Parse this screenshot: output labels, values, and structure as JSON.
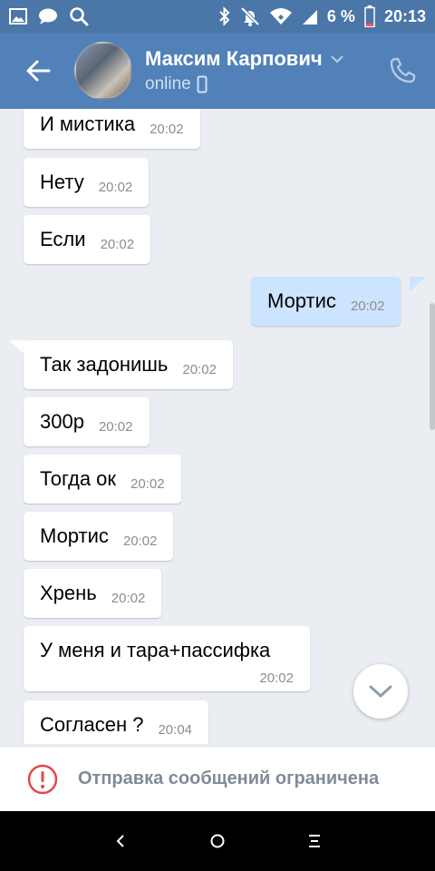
{
  "status_bar": {
    "battery": "6 %",
    "time": "20:13",
    "icons_left": [
      "gallery-icon",
      "chat-bubble-icon",
      "search-icon"
    ],
    "icons_right": [
      "bluetooth-icon",
      "mute-icon",
      "wifi-icon",
      "signal-icon",
      "battery-icon"
    ]
  },
  "header": {
    "contact_name": "Максим Карпович",
    "status": "online",
    "icons": [
      "back-arrow-icon",
      "chevron-down-icon",
      "mobile-icon",
      "phone-icon"
    ]
  },
  "messages": [
    {
      "text": "И мистика",
      "time": "20:02",
      "dir": "in"
    },
    {
      "text": "Нету",
      "time": "20:02",
      "dir": "in"
    },
    {
      "text": "Если",
      "time": "20:02",
      "dir": "in"
    },
    {
      "text": "Мортис",
      "time": "20:02",
      "dir": "out"
    },
    {
      "text": "Так задонишь",
      "time": "20:02",
      "dir": "in"
    },
    {
      "text": "300р",
      "time": "20:02",
      "dir": "in"
    },
    {
      "text": "Тогда ок",
      "time": "20:02",
      "dir": "in"
    },
    {
      "text": "Мортис",
      "time": "20:02",
      "dir": "in"
    },
    {
      "text": "Хрень",
      "time": "20:02",
      "dir": "in"
    },
    {
      "text": "У меня и тара+пассифка",
      "time": "20:02",
      "dir": "in"
    },
    {
      "text": "Согласен ?",
      "time": "20:04",
      "dir": "in"
    }
  ],
  "restriction": {
    "text": "Отправка сообщений ограничена"
  },
  "colors": {
    "header": "#5181b8",
    "status_bar": "#4a76a8",
    "chat_bg": "#eaedf2",
    "outgoing_bubble": "#cce4ff",
    "incoming_bubble": "#ffffff",
    "warning": "#e64646"
  },
  "nav": [
    "back-icon",
    "home-icon",
    "recents-icon"
  ]
}
